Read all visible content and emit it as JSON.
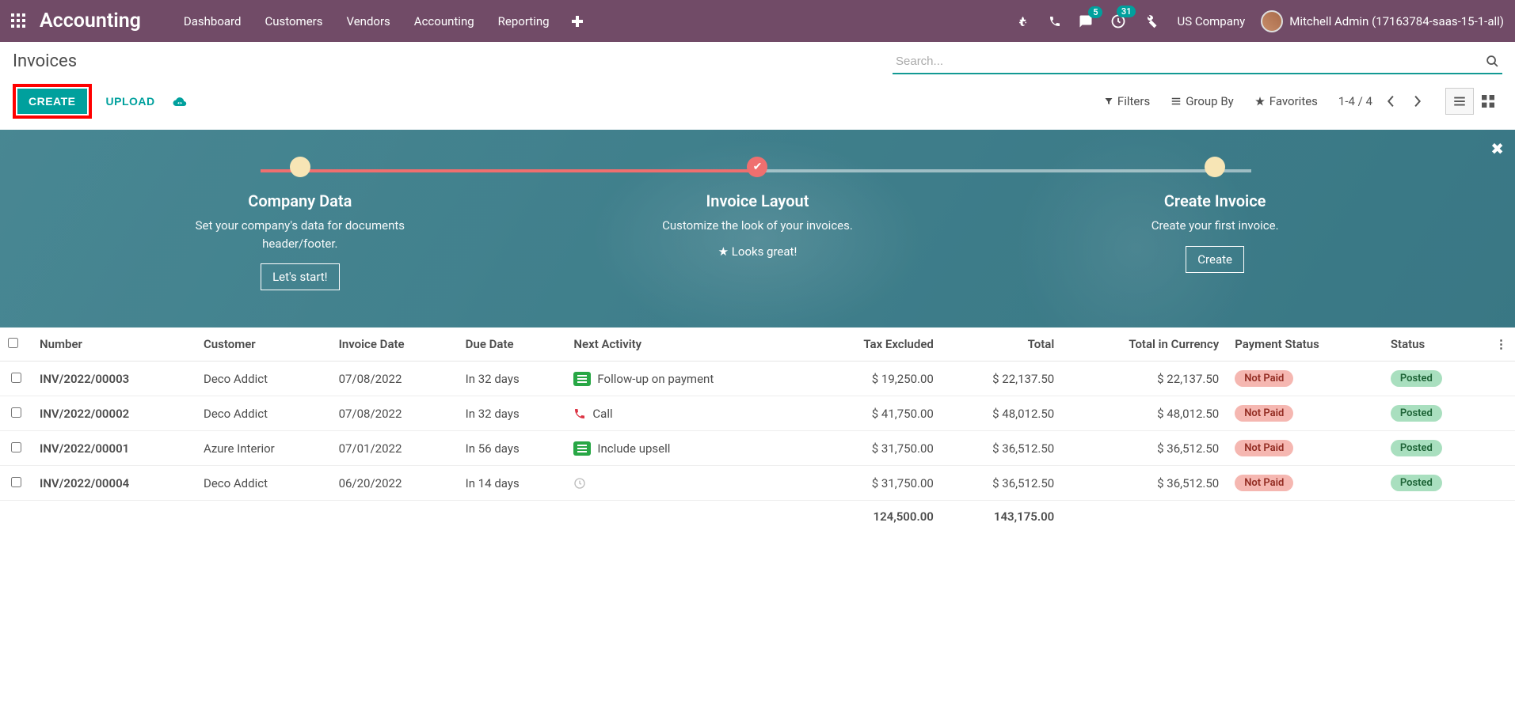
{
  "navbar": {
    "brand": "Accounting",
    "menu": [
      "Dashboard",
      "Customers",
      "Vendors",
      "Accounting",
      "Reporting"
    ],
    "messages_badge": "5",
    "activities_badge": "31",
    "company": "US Company",
    "user": "Mitchell Admin (17163784-saas-15-1-all)"
  },
  "breadcrumb": "Invoices",
  "buttons": {
    "create": "CREATE",
    "upload": "UPLOAD"
  },
  "search": {
    "placeholder": "Search...",
    "filters": "Filters",
    "groupby": "Group By",
    "favorites": "Favorites"
  },
  "pager": {
    "range": "1-4 / 4"
  },
  "banner": {
    "steps": [
      {
        "title": "Company Data",
        "desc": "Set your company's data for documents header/footer.",
        "button": "Let's start!",
        "state": "todo",
        "extra": null
      },
      {
        "title": "Invoice Layout",
        "desc": "Customize the look of your invoices.",
        "button": null,
        "state": "done",
        "extra": "Looks great!"
      },
      {
        "title": "Create Invoice",
        "desc": "Create your first invoice.",
        "button": "Create",
        "state": "todo",
        "extra": null
      }
    ]
  },
  "table": {
    "headers": {
      "number": "Number",
      "customer": "Customer",
      "invoice_date": "Invoice Date",
      "due_date": "Due Date",
      "next_activity": "Next Activity",
      "tax_excl": "Tax Excluded",
      "total": "Total",
      "total_curr": "Total in Currency",
      "pay": "Payment Status",
      "status": "Status"
    },
    "rows": [
      {
        "number": "INV/2022/00003",
        "customer": "Deco Addict",
        "invoice_date": "07/08/2022",
        "due_date": "In 32 days",
        "activity": {
          "icon": "lines-green",
          "text": "Follow-up on payment"
        },
        "tax_excl": "$ 19,250.00",
        "total": "$ 22,137.50",
        "total_curr": "$ 22,137.50",
        "pay": "Not Paid",
        "status": "Posted"
      },
      {
        "number": "INV/2022/00002",
        "customer": "Deco Addict",
        "invoice_date": "07/08/2022",
        "due_date": "In 32 days",
        "activity": {
          "icon": "phone-red",
          "text": "Call"
        },
        "tax_excl": "$ 41,750.00",
        "total": "$ 48,012.50",
        "total_curr": "$ 48,012.50",
        "pay": "Not Paid",
        "status": "Posted"
      },
      {
        "number": "INV/2022/00001",
        "customer": "Azure Interior",
        "invoice_date": "07/01/2022",
        "due_date": "In 56 days",
        "activity": {
          "icon": "lines-green",
          "text": "Include upsell"
        },
        "tax_excl": "$ 31,750.00",
        "total": "$ 36,512.50",
        "total_curr": "$ 36,512.50",
        "pay": "Not Paid",
        "status": "Posted"
      },
      {
        "number": "INV/2022/00004",
        "customer": "Deco Addict",
        "invoice_date": "06/20/2022",
        "due_date": "In 14 days",
        "activity": {
          "icon": "clock",
          "text": ""
        },
        "tax_excl": "$ 31,750.00",
        "total": "$ 36,512.50",
        "total_curr": "$ 36,512.50",
        "pay": "Not Paid",
        "status": "Posted"
      }
    ],
    "totals": {
      "tax_excl": "124,500.00",
      "total": "143,175.00"
    }
  }
}
